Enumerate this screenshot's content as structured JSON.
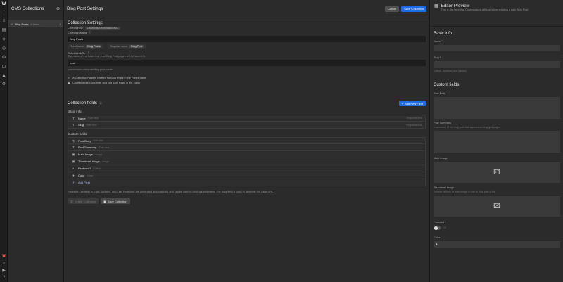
{
  "rail": {
    "logo": "W"
  },
  "collections": {
    "title": "CMS Collections",
    "items": [
      {
        "name": "Blog Posts",
        "count": "0 items"
      }
    ]
  },
  "main": {
    "title": "Blog Post Settings",
    "cancel": "Cancel",
    "save": "Save Collection",
    "settings_heading": "Collection Settings",
    "id_label": "Collection ID:",
    "id_value": "6466f0c36f9e6f05a6d4f6c1",
    "name_label": "Collection Name",
    "name_value": "Blog Posts",
    "plural_label": "Plural name:",
    "plural_value": "Blog Posts",
    "singular_label": "Singular name:",
    "singular_value": "Blog Post",
    "url_label": "Collection URL",
    "url_hint": "The name of the folder that your Blog Post pages will be stored in",
    "url_value": "post",
    "url_preview": "yourdomain.com/post/blog-post-name",
    "note1": "A Collection Page is created for Blog Posts in the Pages panel",
    "note2": "Collaborators can create and edit Blog Posts in the Editor",
    "fields_heading": "Collection fields",
    "add_field": "Add New Field",
    "basic_heading": "Basic info",
    "basic_fields": [
      {
        "icon": "T",
        "name": "Name",
        "type": "Plain text",
        "req": "Required field"
      },
      {
        "icon": "T",
        "name": "Slug",
        "type": "Plain text",
        "req": "Required field"
      }
    ],
    "custom_heading": "Custom fields",
    "custom_fields": [
      {
        "icon": "¶",
        "name": "Post Body",
        "type": "Rich text"
      },
      {
        "icon": "T",
        "name": "Post Summary",
        "type": "Plain text"
      },
      {
        "icon": "▣",
        "name": "Main Image",
        "type": "Image"
      },
      {
        "icon": "▣",
        "name": "Thumbnail image",
        "type": "Image"
      },
      {
        "icon": "◐",
        "name": "Featured?",
        "type": "Switch"
      },
      {
        "icon": "●",
        "name": "Color",
        "type": "Color"
      }
    ],
    "add_field_row": "Add Field",
    "footer_note": "Fields for Created On, Last Updated, and Last Published are generated automatically and can be used in bindings and filters. The Slug field is used to generate the page URL.",
    "delete_btn": "Delete Collection",
    "save_btn2": "Save Collection"
  },
  "preview": {
    "title": "Editor Preview",
    "subtitle": "This is the form that Collaborators will see when creating a new Blog Post",
    "basic_heading": "Basic info",
    "name_label": "Name *",
    "slug_label": "Slug *",
    "slug_hint": "Letters, numbers and dashes",
    "custom_heading": "Custom fields",
    "post_body": "Post Body",
    "post_summary": "Post Summary",
    "post_summary_hint": "A summary of the blog post that appears on blog grid pages",
    "main_image": "Main Image",
    "thumbnail": "Thumbnail image",
    "thumbnail_hint": "Smaller version of main image to use in blog post grids",
    "featured": "Featured?",
    "featured_off": "Off",
    "color": "Color"
  }
}
